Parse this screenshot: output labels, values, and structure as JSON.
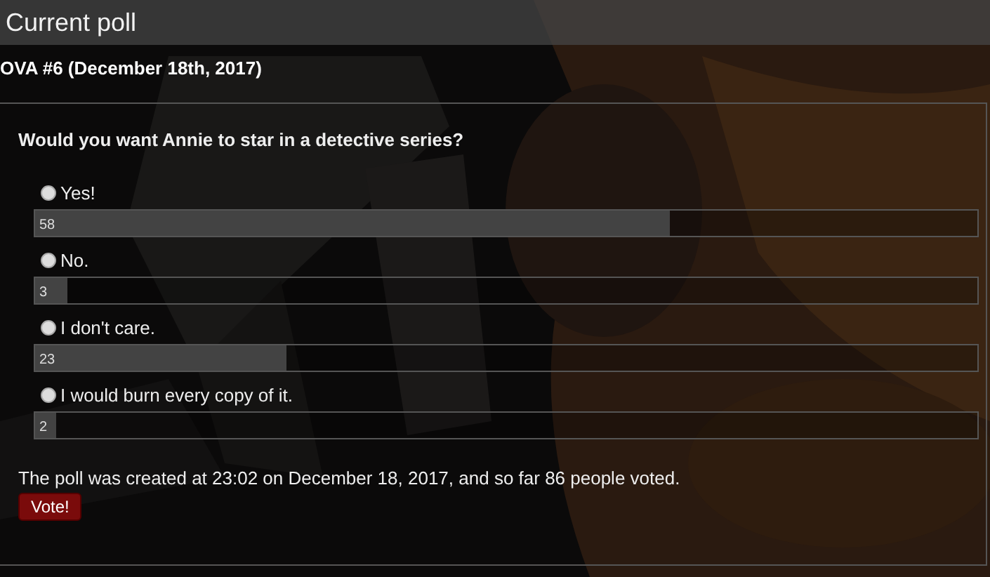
{
  "header": {
    "title": "Current poll"
  },
  "poll": {
    "name": "OVA #6 (December 18th, 2017)",
    "question": "Would you want Annie to star in a detective series?",
    "options": [
      {
        "label": "Yes!",
        "selected": false,
        "count": "58",
        "level": 0.674
      },
      {
        "label": "No.",
        "selected": false,
        "count": "3",
        "level": 0.035
      },
      {
        "label": "I don't care.",
        "selected": false,
        "count": "23",
        "level": 0.267
      },
      {
        "label": "I would burn every copy of it.",
        "selected": false,
        "count": "2",
        "level": 0.023
      }
    ],
    "summary": "The poll was created at 23:02 on December 18, 2017, and so far 86 people voted.",
    "vote_button": "Vote!"
  }
}
